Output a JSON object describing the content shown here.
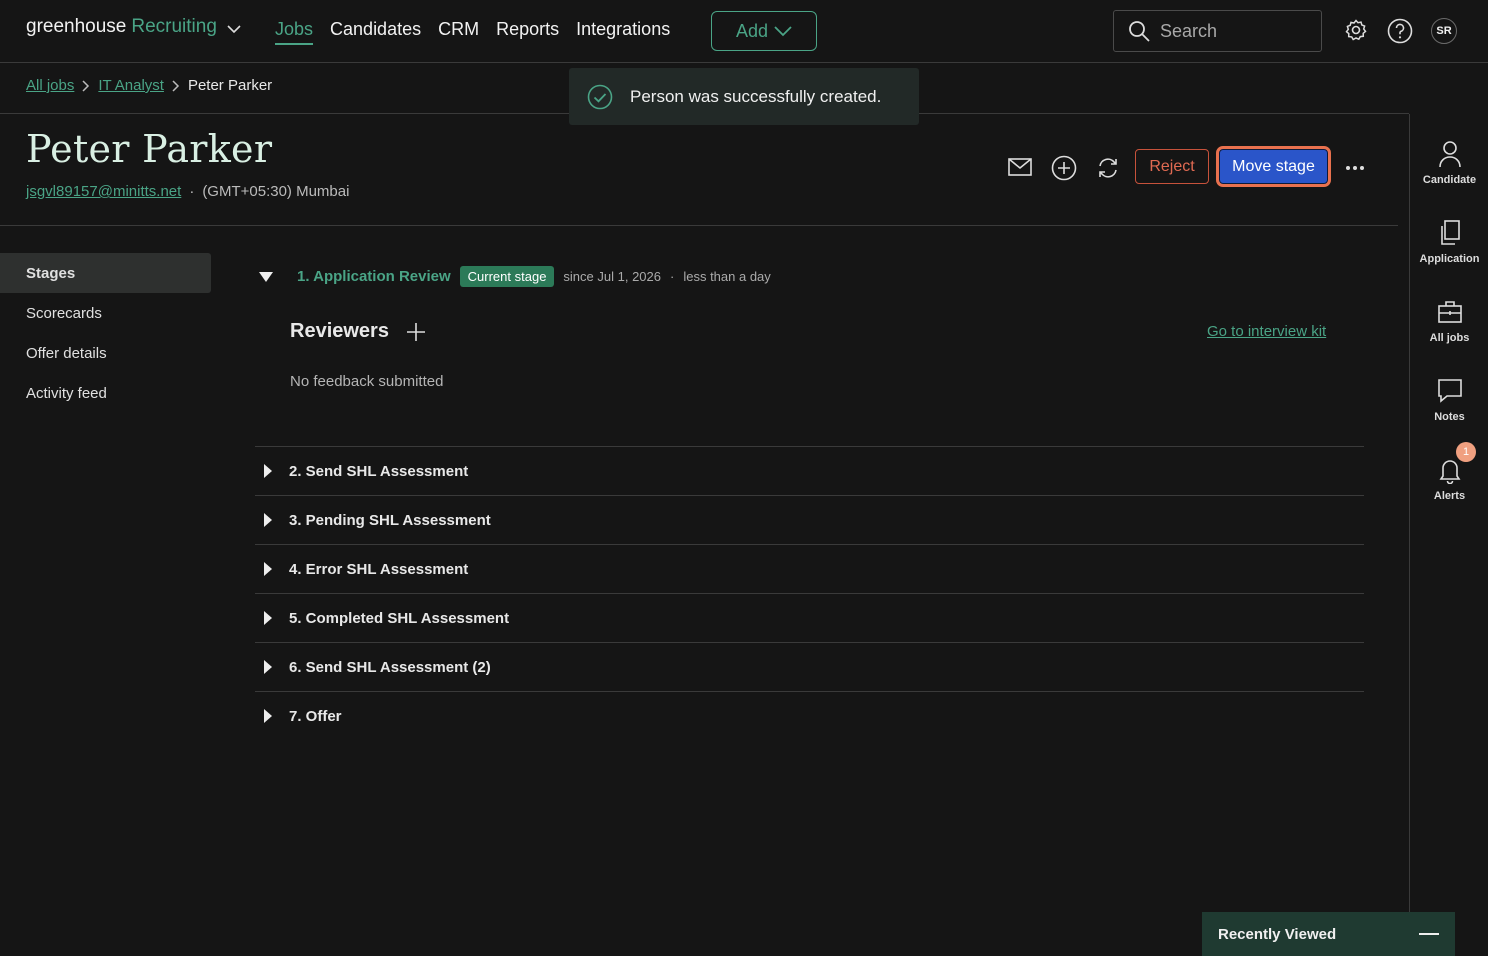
{
  "nav": {
    "logo_main": "greenhouse",
    "logo_sub": "Recruiting",
    "links": [
      "Jobs",
      "Candidates",
      "CRM",
      "Reports",
      "Integrations"
    ],
    "add_label": "Add",
    "search_placeholder": "Search",
    "avatar_initials": "SR"
  },
  "breadcrumb": {
    "all_jobs": "All jobs",
    "job": "IT Analyst",
    "current": "Peter Parker"
  },
  "toast": {
    "message": "Person was successfully created."
  },
  "candidate": {
    "name": "Peter Parker",
    "email": "jsgvl89157@minitts.net",
    "timezone": "(GMT+05:30) Mumbai"
  },
  "actions": {
    "reject": "Reject",
    "move_stage": "Move stage"
  },
  "rail": {
    "candidate": "Candidate",
    "application": "Application",
    "all_jobs": "All jobs",
    "notes": "Notes",
    "alerts": "Alerts",
    "alerts_count": "1"
  },
  "sidenav": [
    "Stages",
    "Scorecards",
    "Offer details",
    "Activity feed"
  ],
  "current_stage": {
    "title": "1. Application Review",
    "badge": "Current stage",
    "since": "since Jul 1, 2026",
    "duration": "less than a day",
    "reviewers_label": "Reviewers",
    "interview_kit": "Go to interview kit",
    "no_feedback": "No feedback submitted"
  },
  "stages": [
    "2. Send SHL Assessment",
    "3. Pending SHL Assessment",
    "4. Error SHL Assessment",
    "5. Completed SHL Assessment",
    "6. Send SHL Assessment (2)",
    "7. Offer"
  ],
  "recently_viewed": "Recently Viewed",
  "colors": {
    "accent": "#4aa486",
    "primary_button": "#2a55c9",
    "reject": "#e06a52",
    "focus_ring": "#e8714e"
  }
}
